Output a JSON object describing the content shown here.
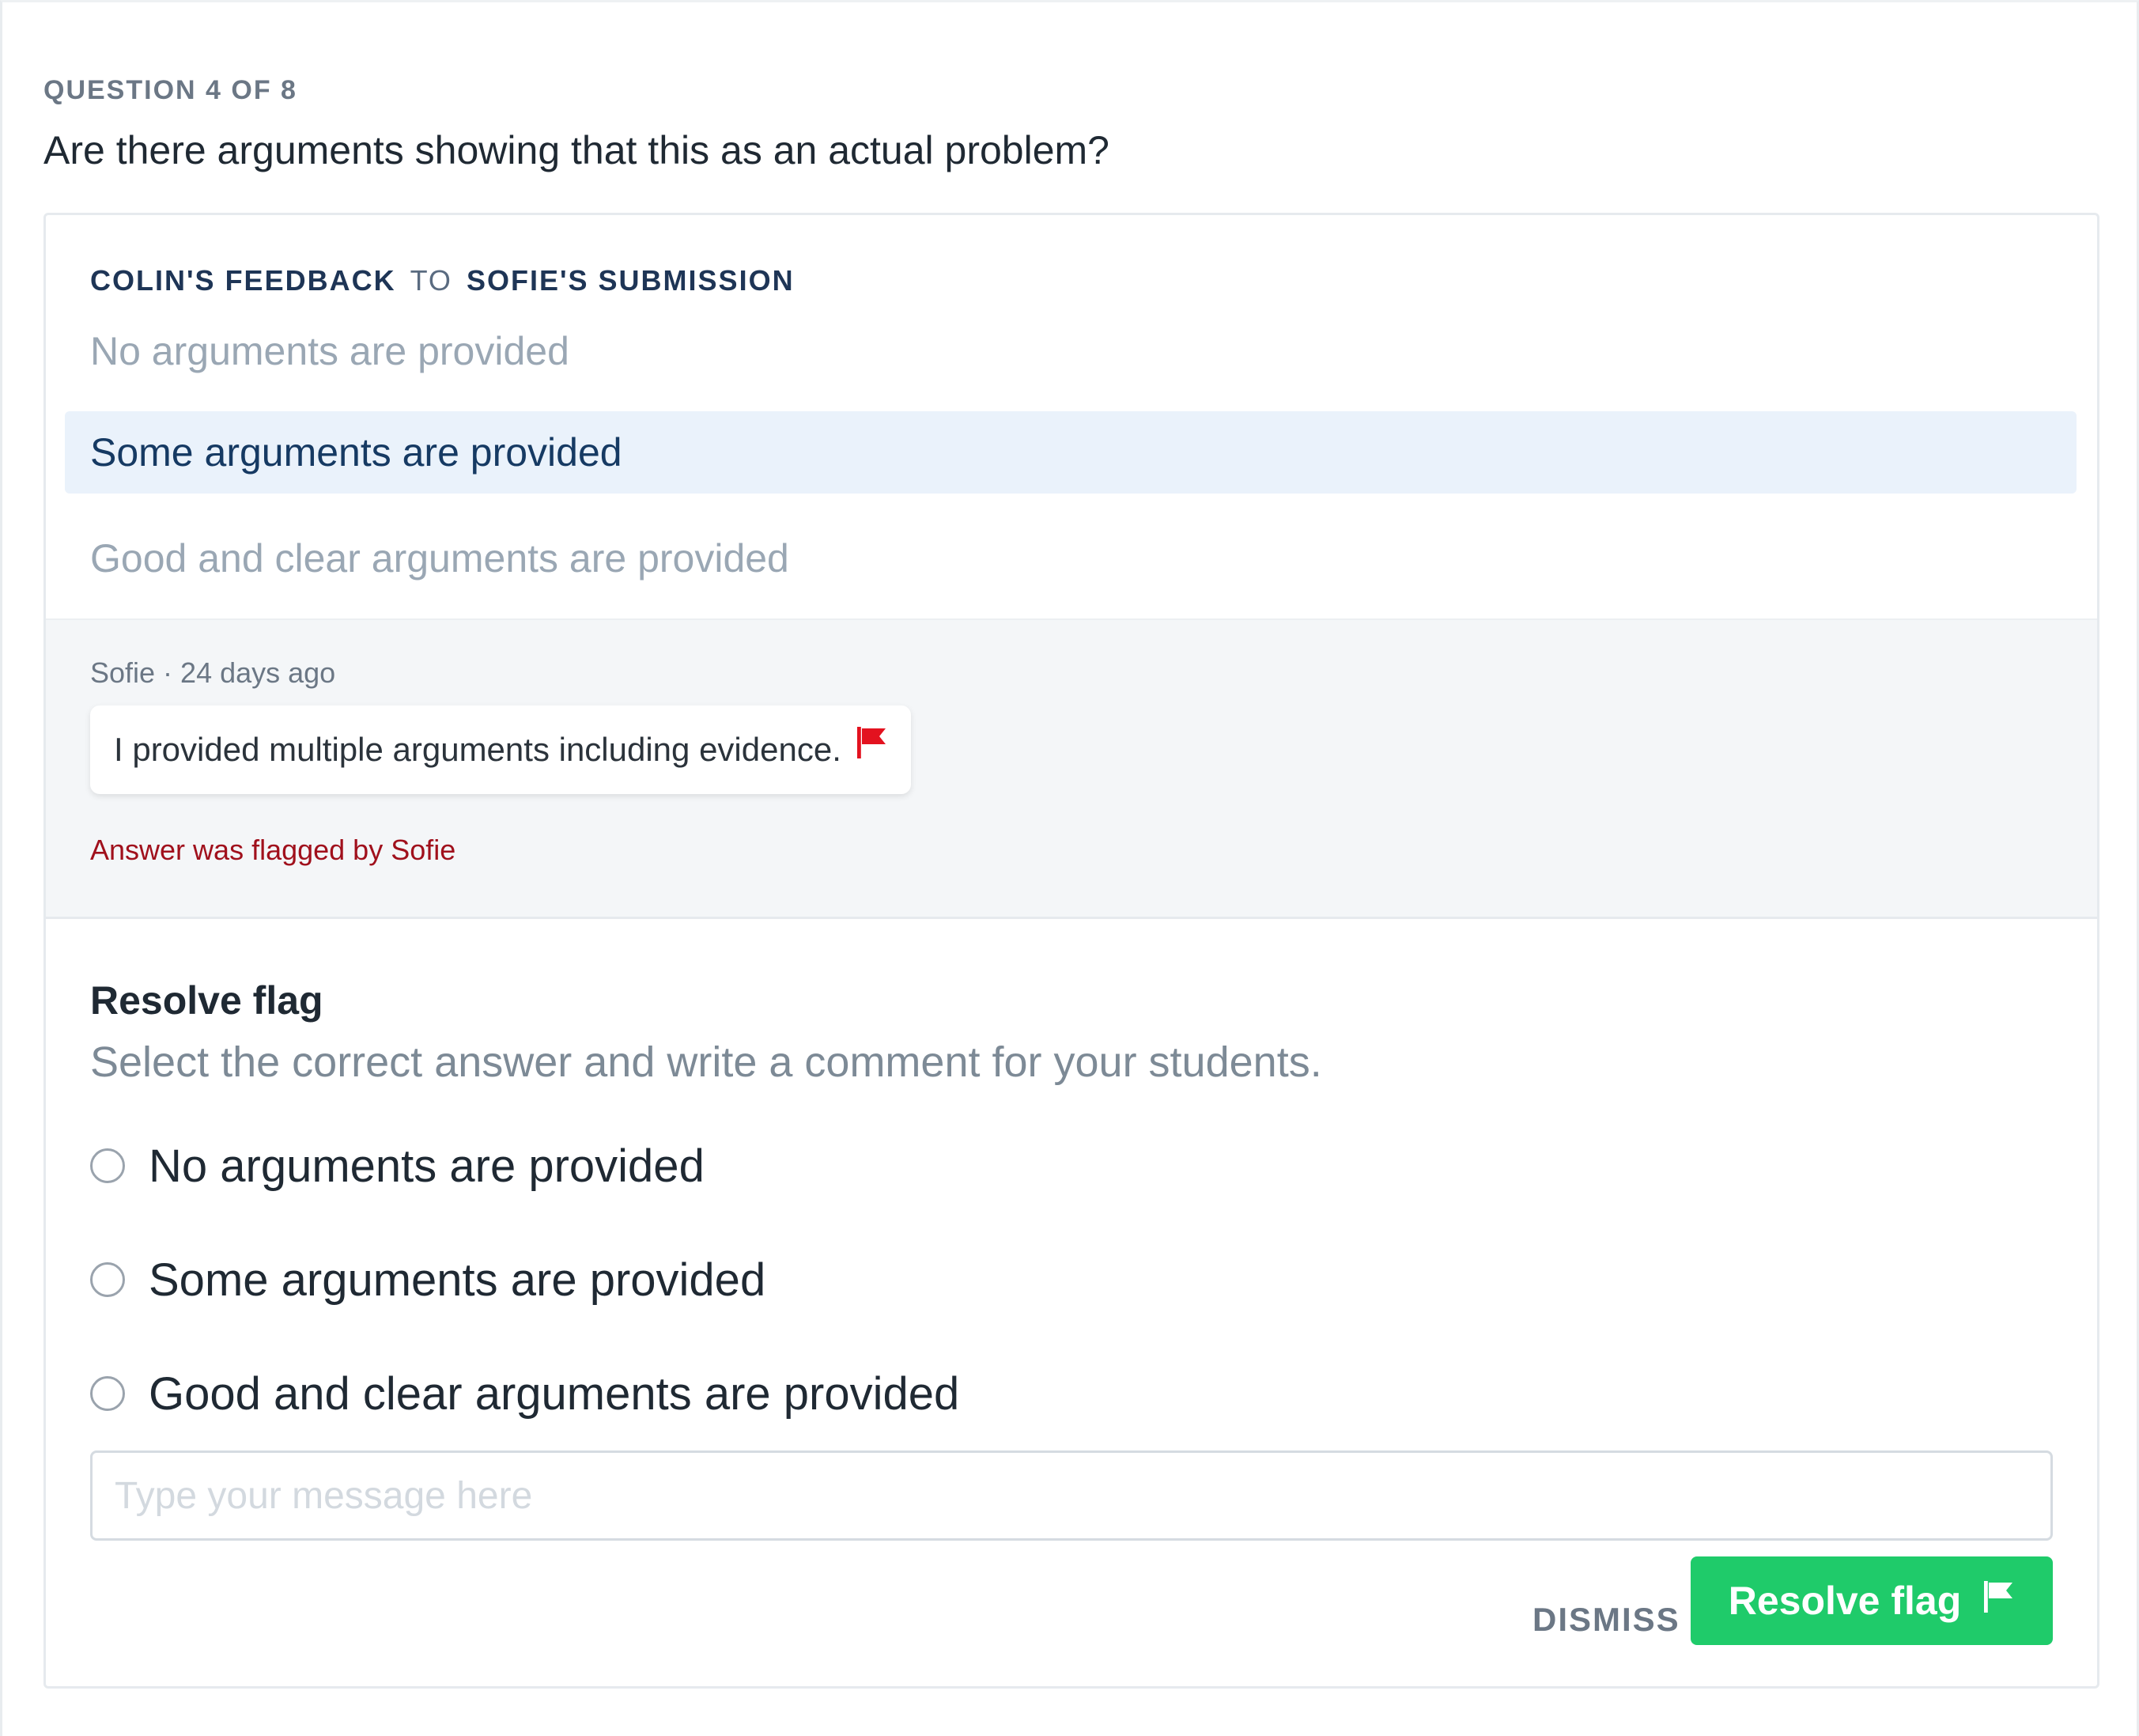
{
  "question": {
    "counter": "QUESTION 4 OF 8",
    "text": "Are there arguments showing that this as an actual problem?"
  },
  "feedback": {
    "giver": "COLIN'S FEEDBACK",
    "connector": "TO",
    "target": "SOFIE'S SUBMISSION",
    "options": [
      {
        "label": "No arguments are provided",
        "selected": false
      },
      {
        "label": "Some arguments are provided",
        "selected": true
      },
      {
        "label": "Good and clear arguments are provided",
        "selected": false
      }
    ]
  },
  "comment": {
    "meta": "Sofie · 24 days ago",
    "text": "I provided multiple arguments including evidence.",
    "flag_icon": "flag-icon",
    "flag_note": "Answer was flagged by Sofie"
  },
  "resolve": {
    "title": "Resolve flag",
    "subtitle": "Select the correct answer and write a comment for your students.",
    "options": [
      {
        "label": "No arguments are provided",
        "checked": false
      },
      {
        "label": "Some arguments are provided",
        "checked": false
      },
      {
        "label": "Good and clear arguments are provided",
        "checked": false
      }
    ],
    "message_placeholder": "Type your message here",
    "message_value": "",
    "dismiss_label": "DISMISS",
    "resolve_label": "Resolve flag"
  },
  "colors": {
    "accent_green": "#1fcb6a",
    "flag_red": "#e3121f",
    "selected_bg": "#eaf2fb"
  }
}
